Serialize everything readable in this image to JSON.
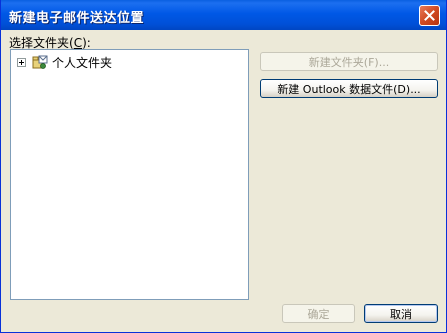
{
  "window": {
    "title": "新建电子邮件送达位置",
    "close_icon": "close-icon"
  },
  "folder_picker": {
    "label_prefix": "选择文件夹(",
    "label_accel": "C",
    "label_suffix": "):",
    "tree": [
      {
        "label": "个人文件夹",
        "icon": "personal-folders-icon",
        "expander": "plus"
      }
    ]
  },
  "buttons": {
    "new_folder": "新建文件夹(F)...",
    "new_folder_enabled": false,
    "new_outlook_data_file": "新建 Outlook 数据文件(D)...",
    "ok": "确定",
    "ok_enabled": false,
    "cancel": "取消"
  },
  "colors": {
    "titlebar": "#0058e6",
    "close_button": "#d04a22",
    "dialog_background": "#ece9d8",
    "disabled_text": "#aca899"
  }
}
